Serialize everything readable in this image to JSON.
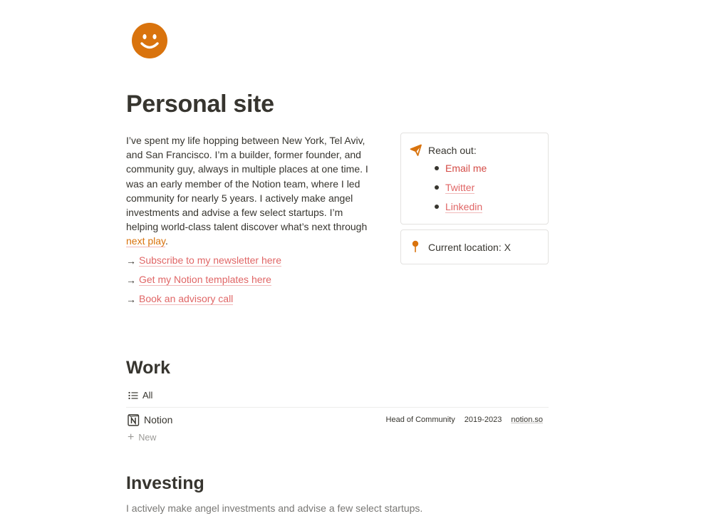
{
  "page": {
    "icon": "smiley-face-icon",
    "title": "Personal site",
    "accent_color": "#d9730d"
  },
  "intro": {
    "paragraph": "I’ve spent my life hopping between New York, Tel Aviv, and San Francisco. I’m a builder, former founder, and community guy, always in multiple places at one time. I was an early member of the Notion team, where I led community for nearly 5 years. I actively make angel investments and advise a few select startups. I’m helping world-class talent discover what’s next through ",
    "paragraph_link": "next play",
    "paragraph_end": "."
  },
  "links": [
    {
      "arrow": "→",
      "label": "Subscribe to my newsletter here"
    },
    {
      "arrow": "→",
      "label": "Get my Notion templates here"
    },
    {
      "arrow": "→",
      "label": "Book an advisory call"
    }
  ],
  "reach_out": {
    "icon": "paper-plane-icon",
    "heading": "Reach out:",
    "items": [
      "Email me",
      "Twitter",
      "Linkedin"
    ]
  },
  "location": {
    "icon": "pushpin-icon",
    "label": "Current location: X"
  },
  "work": {
    "heading": "Work",
    "view_tab": "All",
    "rows": [
      {
        "icon": "notion-logo-icon",
        "name": "Notion",
        "role": "Head of Community",
        "years": "2019-2023",
        "url": "notion.so"
      }
    ],
    "new_label": "New"
  },
  "investing": {
    "heading": "Investing",
    "description": "I actively make angel investments and advise a few select startups."
  }
}
